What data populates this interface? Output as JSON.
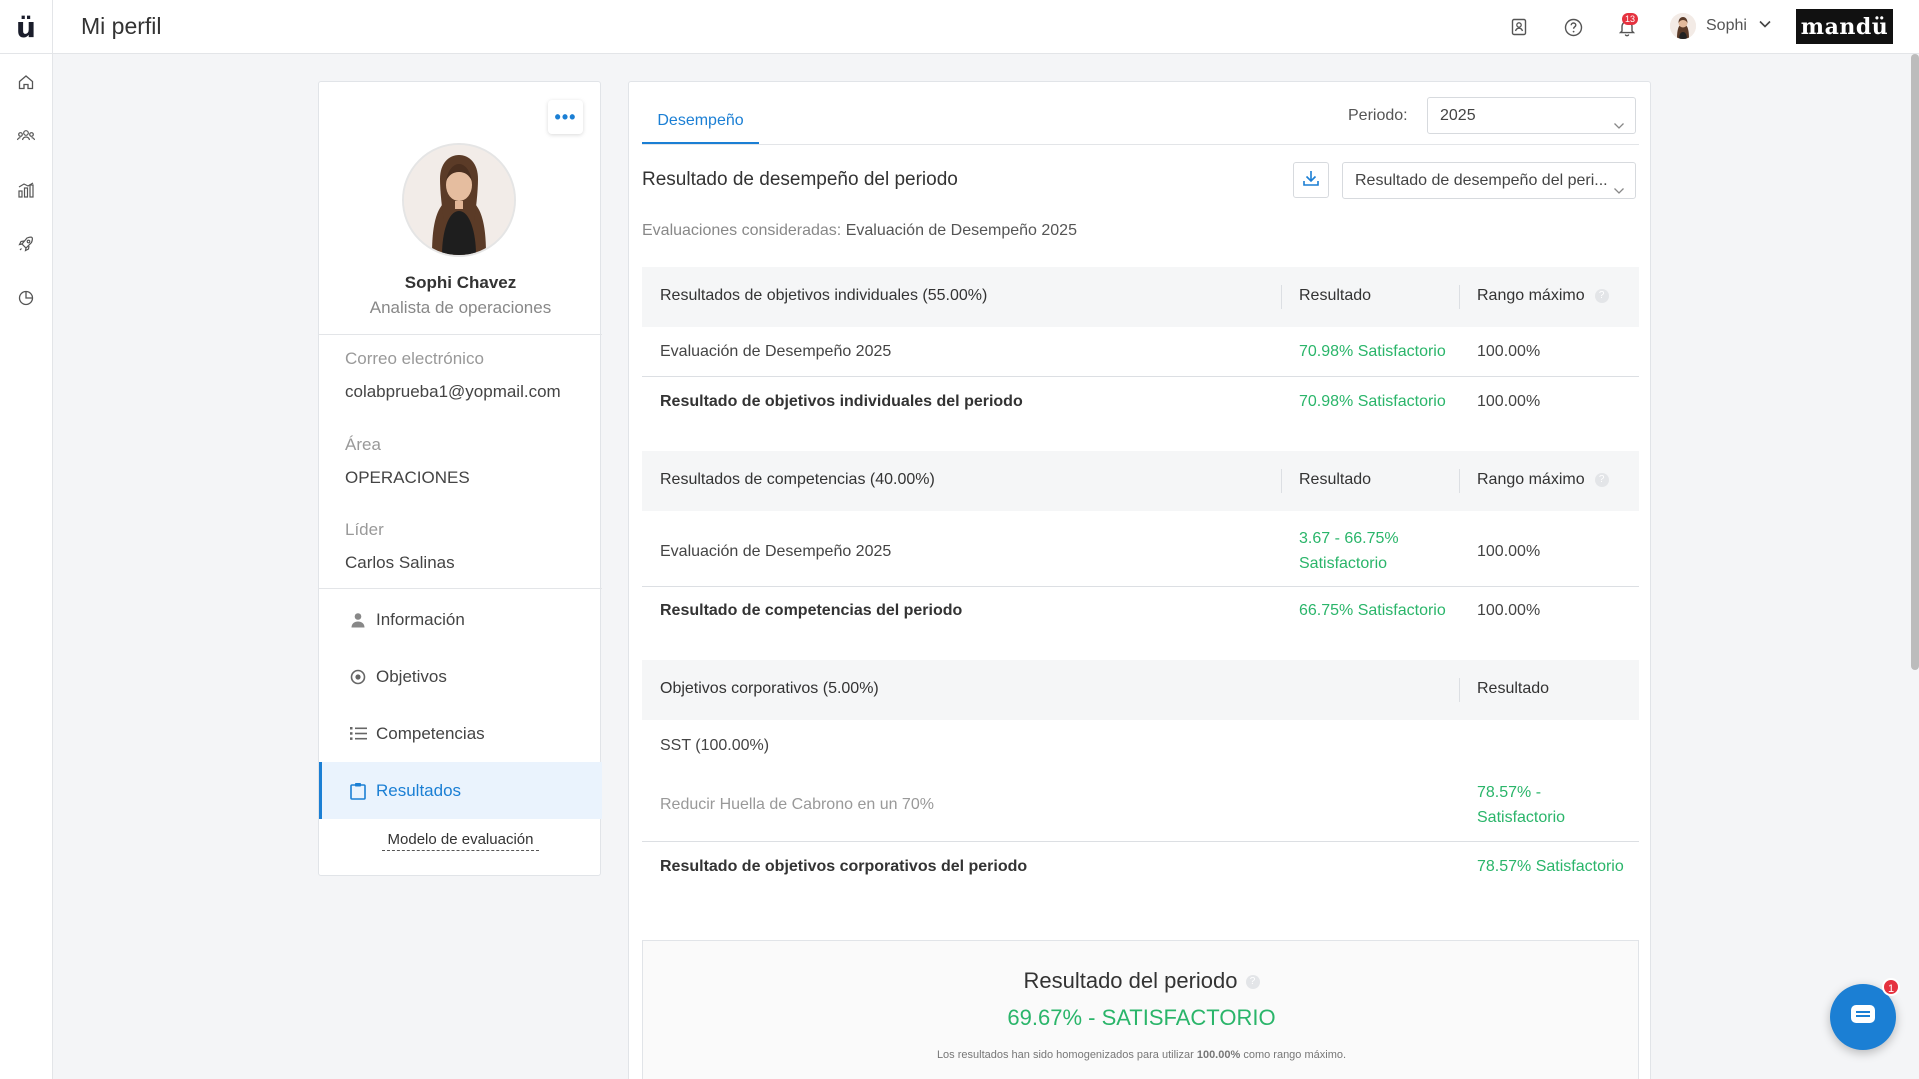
{
  "header": {
    "logo": "ü",
    "title": "Mi perfil",
    "notifications_count": "13",
    "user_name": "Sophi",
    "brand": "mandü",
    "icons": [
      "contact-card-icon",
      "help-icon",
      "bell-icon",
      "chevron-down-icon"
    ]
  },
  "leftnav": {
    "icons": [
      "home-icon",
      "people-icon",
      "chart-icon",
      "rocket-icon",
      "pie-chart-icon"
    ],
    "expand": "»"
  },
  "profile": {
    "more": "•••",
    "name": "Sophi Chavez",
    "role": "Analista de operaciones",
    "email_label": "Correo electrónico",
    "email": "colabprueba1@yopmail.com",
    "area_label": "Área",
    "area": "OPERACIONES",
    "leader_label": "Líder",
    "leader": "Carlos Salinas",
    "menu": [
      {
        "label": "Información",
        "icon": "person-icon",
        "active": false
      },
      {
        "label": "Objetivos",
        "icon": "target-icon",
        "active": false
      },
      {
        "label": "Competencias",
        "icon": "list-icon",
        "active": false
      },
      {
        "label": "Resultados",
        "icon": "clipboard-icon",
        "active": true
      }
    ],
    "model_link": "Modelo de evaluación"
  },
  "main": {
    "tab": "Desempeño",
    "period_label": "Periodo:",
    "period_value": "2025",
    "section_title": "Resultado de desempeño del periodo",
    "view_select": "Resultado de desempeño del peri...",
    "eval_label": "Evaluaciones consideradas:",
    "eval_value": "Evaluación de Desempeño 2025",
    "individual": {
      "header": "Resultados de objetivos individuales (55.00%)",
      "col_result": "Resultado",
      "col_max": "Rango máximo",
      "rows": [
        {
          "name": "Evaluación de Desempeño 2025",
          "result": "70.98% Satisfactorio",
          "max": "100.00%"
        },
        {
          "name": "Resultado de objetivos individuales del periodo",
          "result": "70.98% Satisfactorio",
          "max": "100.00%"
        }
      ]
    },
    "competencies": {
      "header": "Resultados de competencias (40.00%)",
      "col_result": "Resultado",
      "col_max": "Rango máximo",
      "rows": [
        {
          "name": "Evaluación de Desempeño 2025",
          "result_line1": "3.67 - 66.75%",
          "result_line2": "Satisfactorio",
          "max": "100.00%"
        },
        {
          "name": "Resultado de competencias del periodo",
          "result": "66.75% Satisfactorio",
          "max": "100.00%"
        }
      ]
    },
    "corporate": {
      "header": "Objetivos corporativos (5.00%)",
      "col_result": "Resultado",
      "group": "SST (100.00%)",
      "item": "Reducir Huella de Cabrono en un 70%",
      "item_result_line1": "78.57% -",
      "item_result_line2": "Satisfactorio",
      "total_name": "Resultado de objetivos corporativos del periodo",
      "total_result": "78.57% Satisfactorio"
    },
    "summary": {
      "title": "Resultado del periodo",
      "value": "69.67% - SATISFACTORIO",
      "note_pre": "Los resultados han sido homogenizados para utilizar",
      "note_bold": "100.00%",
      "note_post": "como rango máximo."
    }
  },
  "chat": {
    "badge": "1"
  },
  "colors": {
    "accent": "#1b7fd4",
    "success": "#2ab56a",
    "danger": "#e5323f"
  }
}
